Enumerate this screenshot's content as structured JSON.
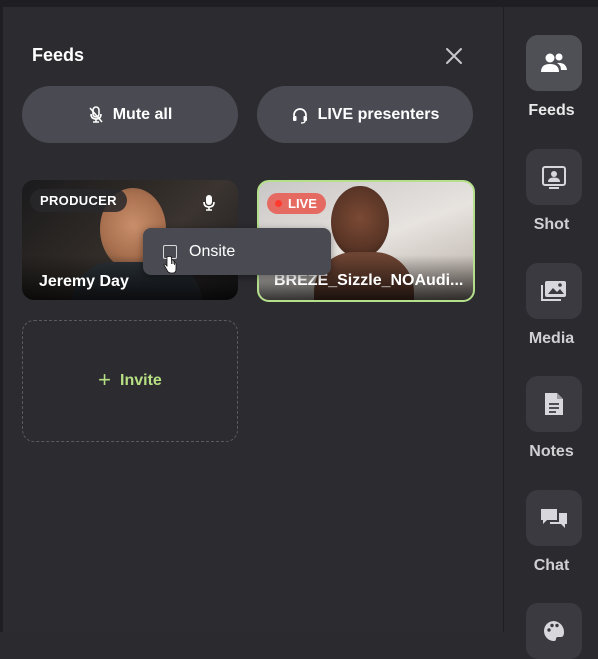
{
  "panel": {
    "title": "Feeds",
    "mute_all_label": "Mute all",
    "live_presenters_label": "LIVE presenters",
    "invite_label": "Invite"
  },
  "tiles": [
    {
      "badge": "PRODUCER",
      "name": "Jeremy Day"
    },
    {
      "badge": "LIVE",
      "name": "BREZE_Sizzle_NOAudi..."
    }
  ],
  "tooltip": {
    "label": "Onsite"
  },
  "rail": {
    "items": [
      {
        "label": "Feeds",
        "icon": "users-icon",
        "active": true
      },
      {
        "label": "Shot",
        "icon": "shot-icon",
        "active": false
      },
      {
        "label": "Media",
        "icon": "media-icon",
        "active": false
      },
      {
        "label": "Notes",
        "icon": "notes-icon",
        "active": false
      },
      {
        "label": "Chat",
        "icon": "chat-icon",
        "active": false
      },
      {
        "label": "",
        "icon": "palette-icon",
        "active": false
      }
    ]
  },
  "colors": {
    "accent_green": "#b7df83",
    "live_red": "#e56b62",
    "panel_bg": "#2b2b30",
    "button_bg": "#4a4a52"
  }
}
